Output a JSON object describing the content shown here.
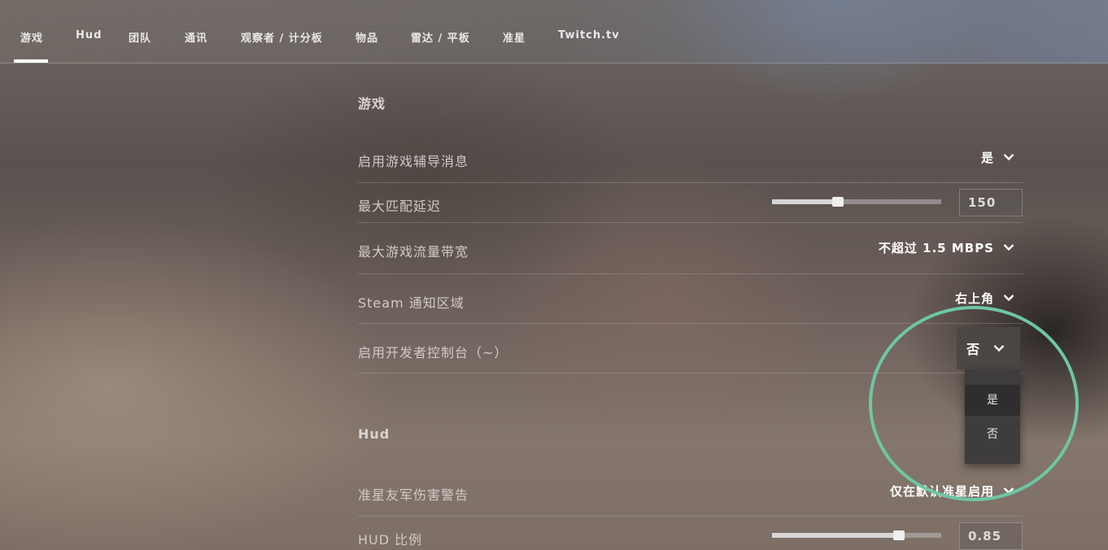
{
  "nav": {
    "tabs": [
      {
        "label": "游戏",
        "active": true
      },
      {
        "label": "Hud"
      },
      {
        "label": "团队"
      },
      {
        "label": "通讯"
      },
      {
        "label": "观察者 / 计分板"
      },
      {
        "label": "物品"
      },
      {
        "label": "雷达 / 平板"
      },
      {
        "label": "准星"
      },
      {
        "label": "Twitch.tv"
      }
    ]
  },
  "sections": {
    "game": {
      "title": "游戏",
      "rows": {
        "tutor_messages": {
          "label": "启用游戏辅导消息",
          "value": "是"
        },
        "max_ping": {
          "label": "最大匹配延迟",
          "value": "150",
          "slider_fraction": 0.39
        },
        "bandwidth": {
          "label": "最大游戏流量带宽",
          "value": "不超过 1.5 MBPS"
        },
        "steam_notify": {
          "label": "Steam 通知区域",
          "value": "右上角"
        },
        "dev_console": {
          "label": "启用开发者控制台（~）",
          "value": "否"
        }
      }
    },
    "hud": {
      "title": "Hud",
      "rows": {
        "ff_warning": {
          "label": "准星友军伤害警告",
          "value": "仅在默认准星启用"
        },
        "hud_scale": {
          "label": "HUD 比例",
          "value": "0.85",
          "slider_fraction": 0.75
        }
      }
    }
  },
  "dev_console_menu": {
    "options": [
      "是",
      "否"
    ]
  },
  "colors": {
    "highlight_ring": "#6ec6a4",
    "menu_bg": "#3e3c3c"
  },
  "icons": {
    "dropdown": "chevron-down-icon"
  }
}
